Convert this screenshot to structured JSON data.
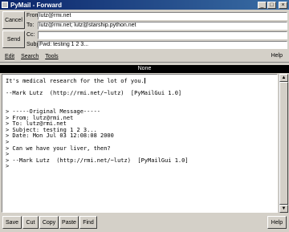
{
  "window": {
    "title": "PyMail - Forward",
    "minimize_glyph": "_",
    "maximize_glyph": "□",
    "close_glyph": "×"
  },
  "buttons": {
    "cancel": "Cancel",
    "send": "Send"
  },
  "fields": [
    {
      "label": "From:",
      "value": "lutz@rmi.net"
    },
    {
      "label": "To:",
      "value": "lutz@rmi.net; lutz@starship.python.net"
    },
    {
      "label": "Cc:",
      "value": ""
    },
    {
      "label": "Subj:",
      "value": "Fwd: testing 1 2 3..."
    }
  ],
  "menu": {
    "edit": "Edit",
    "search": "Search",
    "tools": "Tools",
    "help": "Help"
  },
  "status": "None",
  "message_lines": [
    "It's medical research for the lot of you.",
    "",
    "--Mark Lutz  (http://rmi.net/~lutz)  [PyMailGui 1.0]",
    "",
    "",
    "> -----Original Message-----",
    "> From: lutz@rmi.net",
    "> To: lutz@rmi.net",
    "> Subject: testing 1 2 3...",
    "> Date: Mon Jul 03 12:08:08 2000",
    ">",
    "> Can we have your liver, then?",
    ">",
    "> --Mark Lutz  (http://rmi.net/~lutz)  [PyMailGui 1.0]",
    ">"
  ],
  "toolbar": {
    "save": "Save",
    "cut": "Cut",
    "copy": "Copy",
    "paste": "Paste",
    "find": "Find",
    "help": "Help"
  },
  "scrollbar": {
    "up_glyph": "▲",
    "down_glyph": "▼"
  }
}
